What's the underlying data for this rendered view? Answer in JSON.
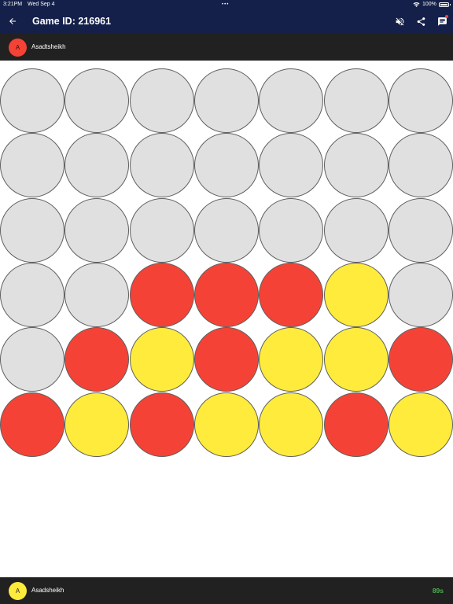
{
  "status_bar": {
    "time": "3:21PM",
    "date": "Wed Sep 4",
    "battery": "100%"
  },
  "header": {
    "title": "Game ID: 216961",
    "back_icon": "arrow-left-icon",
    "actions": [
      "volume-off-icon",
      "share-icon",
      "chat-icon"
    ],
    "background": "#14204a"
  },
  "players": {
    "top": {
      "initial": "A",
      "name": "Asadtsheikh",
      "color": "red"
    },
    "bottom": {
      "initial": "A",
      "name": "Asadsheikh",
      "color": "yellow",
      "timer": "89s"
    }
  },
  "board": {
    "columns": 7,
    "rows": 6,
    "cells": [
      [
        "empty",
        "empty",
        "empty",
        "empty",
        "empty",
        "empty",
        "empty"
      ],
      [
        "empty",
        "empty",
        "empty",
        "empty",
        "empty",
        "empty",
        "empty"
      ],
      [
        "empty",
        "empty",
        "empty",
        "empty",
        "empty",
        "empty",
        "empty"
      ],
      [
        "empty",
        "empty",
        "red",
        "red",
        "red",
        "yellow",
        "empty"
      ],
      [
        "empty",
        "red",
        "yellow",
        "red",
        "yellow",
        "yellow",
        "red"
      ],
      [
        "red",
        "yellow",
        "red",
        "yellow",
        "yellow",
        "red",
        "yellow"
      ]
    ],
    "colors": {
      "red": "#f44336",
      "yellow": "#ffeb3b",
      "empty": "#e0e0e0"
    }
  }
}
